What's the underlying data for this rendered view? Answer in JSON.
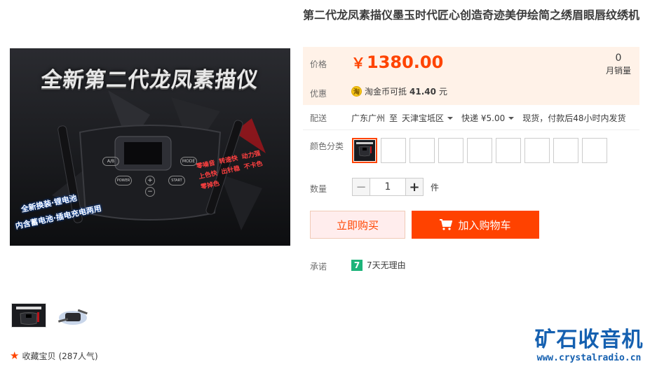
{
  "product": {
    "title": "第二代龙凤素描仪墨玉时代匠心创造奇迹美伊绘简之绣眉眼唇纹绣机",
    "image_headline": "全新第二代龙凤素描仪",
    "image_side_text_1": "全新换装·锂电池",
    "image_side_text_2": "内含蓄电池·插电充电两用",
    "image_features": [
      "零噪音",
      "转速快",
      "动力强",
      "上色快",
      "出针稳",
      "不卡色",
      "零掉色"
    ],
    "device_buttons": [
      "A/B",
      "MODE",
      "POWER",
      "START",
      "+",
      "−"
    ]
  },
  "price": {
    "label": "价格",
    "currency": "￥",
    "amount": "1380.00",
    "sold_count": "0",
    "sold_label": "月销量"
  },
  "promo": {
    "label": "优惠",
    "coin_icon_text": "淘",
    "text_prefix": "淘金币可抵",
    "amount": "41.40",
    "text_suffix": "元"
  },
  "delivery": {
    "label": "配送",
    "from": "广东广州",
    "to_word": "至",
    "to": "天津宝坻区",
    "shipping": "快递 ¥5.00",
    "stock": "现货，付款后48小时内发货"
  },
  "options": {
    "color_label": "颜色分类",
    "swatch_count": 9,
    "selected_index": 0
  },
  "quantity": {
    "label": "数量",
    "minus": "−",
    "plus": "+",
    "value": "1",
    "unit": "件"
  },
  "actions": {
    "buy_now": "立即购买",
    "add_to_cart": "加入购物车"
  },
  "promise": {
    "label": "承诺",
    "icon_text": "7",
    "text": "7天无理由"
  },
  "favorite": {
    "label": "收藏宝贝",
    "count": "(287人气)"
  },
  "watermark": {
    "name": "矿石收音机",
    "url": "www.crystalradio.cn"
  },
  "colors": {
    "accent": "#ff4400",
    "price_bg": "#fff2e8",
    "watermark": "#1560b0"
  }
}
